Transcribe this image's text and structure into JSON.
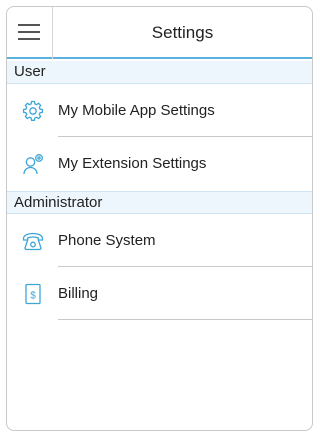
{
  "header": {
    "title": "Settings",
    "menu_icon": "hamburger-menu-icon"
  },
  "sections": {
    "user": {
      "label": "User",
      "items": [
        {
          "label": "My Mobile App Settings",
          "icon": "gear-icon"
        },
        {
          "label": "My Extension Settings",
          "icon": "user-settings-icon"
        }
      ]
    },
    "administrator": {
      "label": "Administrator",
      "items": [
        {
          "label": "Phone System",
          "icon": "telephone-icon"
        },
        {
          "label": "Billing",
          "icon": "billing-dollar-icon"
        }
      ]
    }
  },
  "colors": {
    "accent": "#58b4de",
    "section_bg": "#edf6fc",
    "icon": "#3ea6d6"
  }
}
